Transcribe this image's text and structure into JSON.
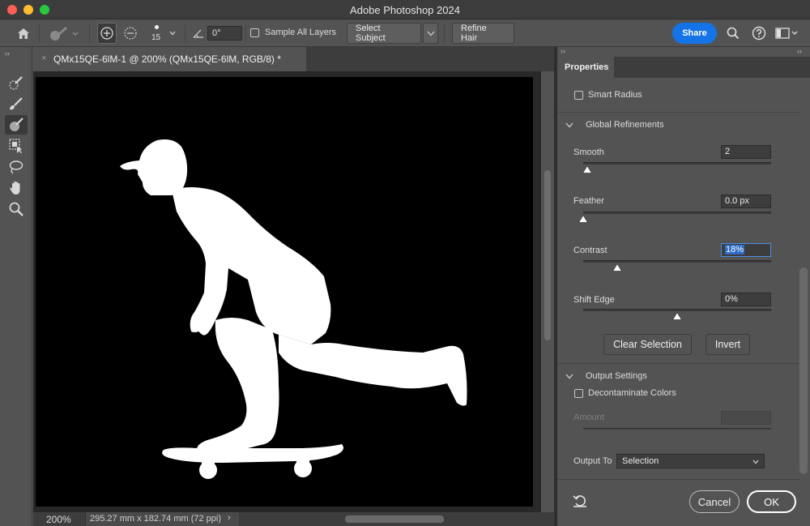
{
  "app": {
    "title": "Adobe Photoshop 2024"
  },
  "options": {
    "brush_size": "15",
    "angle_value": "0°",
    "sample_all_layers": "Sample All Layers",
    "select_subject": "Select Subject",
    "refine_hair": "Refine Hair",
    "share": "Share"
  },
  "document": {
    "tab_title": "QMx15QE-6lM-1 @ 200% (QMx15QE-6lM, RGB/8) *",
    "zoom": "200%",
    "dimensions": "295.27 mm x 182.74 mm (72 ppi)"
  },
  "properties": {
    "tab": "Properties",
    "smart_radius": "Smart Radius",
    "global_refinements": "Global Refinements",
    "smooth": {
      "label": "Smooth",
      "value": "2",
      "level": 0.02
    },
    "feather": {
      "label": "Feather",
      "value": "0.0 px",
      "level": 0.0
    },
    "contrast": {
      "label": "Contrast",
      "value": "18%",
      "level": 0.18
    },
    "shift_edge": {
      "label": "Shift Edge",
      "value": "0%",
      "level": 0.5
    },
    "clear_selection": "Clear Selection",
    "invert": "Invert",
    "output_settings": "Output Settings",
    "decontaminate": "Decontaminate Colors",
    "amount": "Amount",
    "output_to_label": "Output To",
    "output_to_value": "Selection",
    "cancel": "Cancel",
    "ok": "OK"
  },
  "colors": {
    "accent": "#1473e6",
    "panel": "#535353",
    "canvas": "#000000"
  },
  "icons": [
    "home-icon",
    "brush-preset-icon",
    "add-to-selection-icon",
    "subtract-from-selection-icon",
    "angle-icon",
    "search-icon",
    "help-icon",
    "workspace-icon",
    "quick-selection-tool-icon",
    "refine-edge-brush-icon",
    "brush-tool-icon",
    "object-selection-tool-icon",
    "lasso-tool-icon",
    "hand-tool-icon",
    "zoom-tool-icon",
    "reset-icon"
  ]
}
